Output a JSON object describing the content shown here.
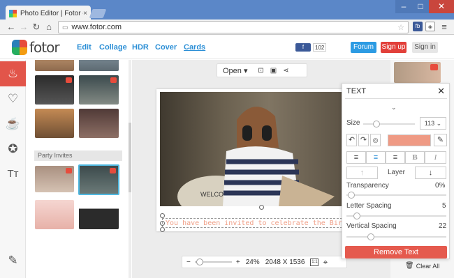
{
  "browser": {
    "tab_title": "Photo Editor | Fotor - Fre",
    "tab_close": "×",
    "url": "www.fotor.com",
    "window_minimize": "–",
    "window_maximize": "□",
    "window_close": "✕",
    "ext_fb": "fb"
  },
  "header": {
    "brand": "fotor",
    "nav": [
      "Edit",
      "Collage",
      "HDR",
      "Cover",
      "Cards"
    ],
    "fb_share": "f",
    "share_count": "102",
    "forum": "Forum",
    "signup": "Sign up",
    "signin": "Sign in"
  },
  "sidebar": {
    "icons": [
      "cake-icon",
      "heart-hands-icon",
      "coffee-icon",
      "star-badge-icon",
      "text-size-icon",
      "edit-square-icon"
    ]
  },
  "templates": {
    "section_label": "Party Invites"
  },
  "toolbar": {
    "open_label": "Open"
  },
  "canvas": {
    "text_line": "You have been invited to celebrate the Birthday of ...",
    "photo_sign": "WELCOME"
  },
  "zoom": {
    "minus": "−",
    "plus": "+",
    "percent": "24%",
    "width": "2048",
    "x": "X",
    "height": "1536",
    "fit_label": "1:1"
  },
  "text_panel": {
    "title": "TEXT",
    "size_label": "Size",
    "size_value": "113",
    "color": "#ef9a84",
    "layer_label": "Layer",
    "transparency_label": "Transparency",
    "transparency_value": "0%",
    "letter_spacing_label": "Letter Spacing",
    "letter_spacing_value": "5",
    "vertical_spacing_label": "Vertical Spacing",
    "vertical_spacing_value": "22",
    "remove_button": "Remove Text"
  },
  "clear_all": "Clear All"
}
